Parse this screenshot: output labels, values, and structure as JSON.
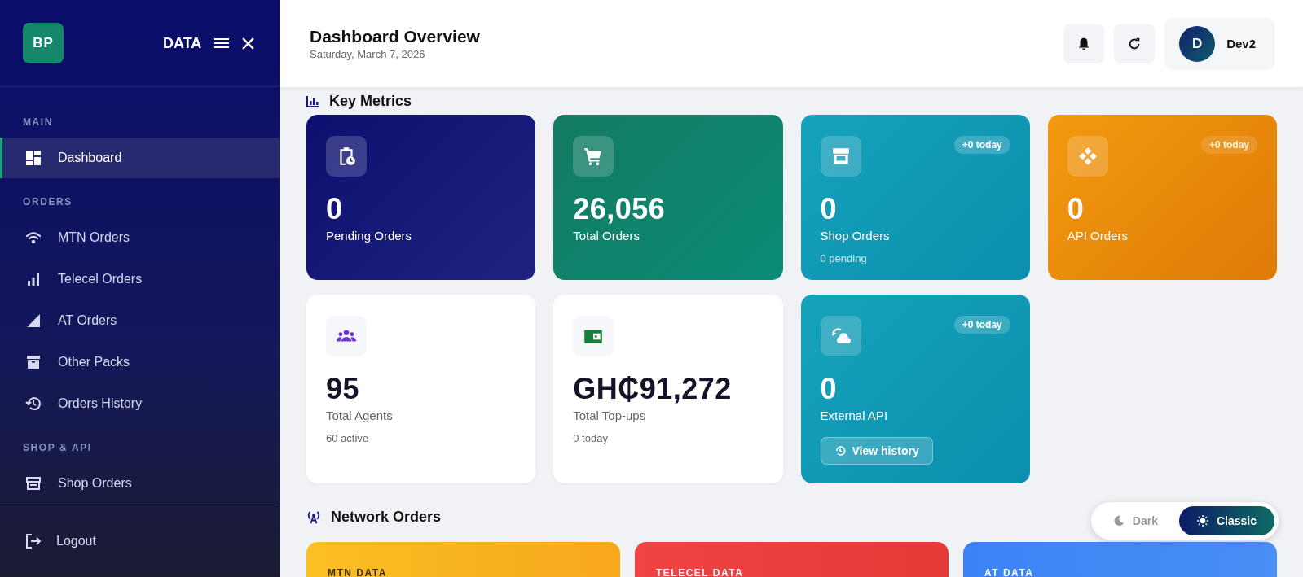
{
  "brand": {
    "logo": "BP",
    "name": "DATA"
  },
  "header": {
    "title": "Dashboard Overview",
    "date": "Saturday, March 7, 2026",
    "user": {
      "initial": "D",
      "name": "Dev2"
    }
  },
  "sidebar": {
    "sections": [
      {
        "heading": "MAIN",
        "items": [
          {
            "label": "Dashboard",
            "selected": true
          }
        ]
      },
      {
        "heading": "ORDERS",
        "items": [
          {
            "label": "MTN Orders",
            "selected": false
          },
          {
            "label": "Telecel Orders",
            "selected": false
          },
          {
            "label": "AT Orders",
            "selected": false
          },
          {
            "label": "Other Packs",
            "selected": false
          },
          {
            "label": "Orders History",
            "selected": false
          }
        ]
      },
      {
        "heading": "SHOP & API",
        "items": [
          {
            "label": "Shop Orders",
            "selected": false
          }
        ]
      }
    ],
    "logout": "Logout"
  },
  "metrics": {
    "heading": "Key Metrics",
    "cards": [
      {
        "value": "0",
        "label": "Pending Orders"
      },
      {
        "value": "26,056",
        "label": "Total Orders"
      },
      {
        "value": "0",
        "label": "Shop Orders",
        "sub": "0 pending",
        "badge": "+0 today"
      },
      {
        "value": "0",
        "label": "API Orders",
        "badge": "+0 today"
      },
      {
        "value": "95",
        "label": "Total Agents",
        "sub": "60 active"
      },
      {
        "value": "GH₵91,272",
        "label": "Total Top-ups",
        "sub": "0 today"
      },
      {
        "value": "0",
        "label": "External API",
        "badge": "+0 today",
        "button": "View history"
      }
    ]
  },
  "network": {
    "heading": "Network Orders",
    "cards": [
      {
        "label": "MTN DATA"
      },
      {
        "label": "TELECEL DATA"
      },
      {
        "label": "AT DATA"
      }
    ]
  },
  "theme": [
    {
      "label": "Dark",
      "selected": false
    },
    {
      "label": "Classic",
      "selected": true
    }
  ]
}
